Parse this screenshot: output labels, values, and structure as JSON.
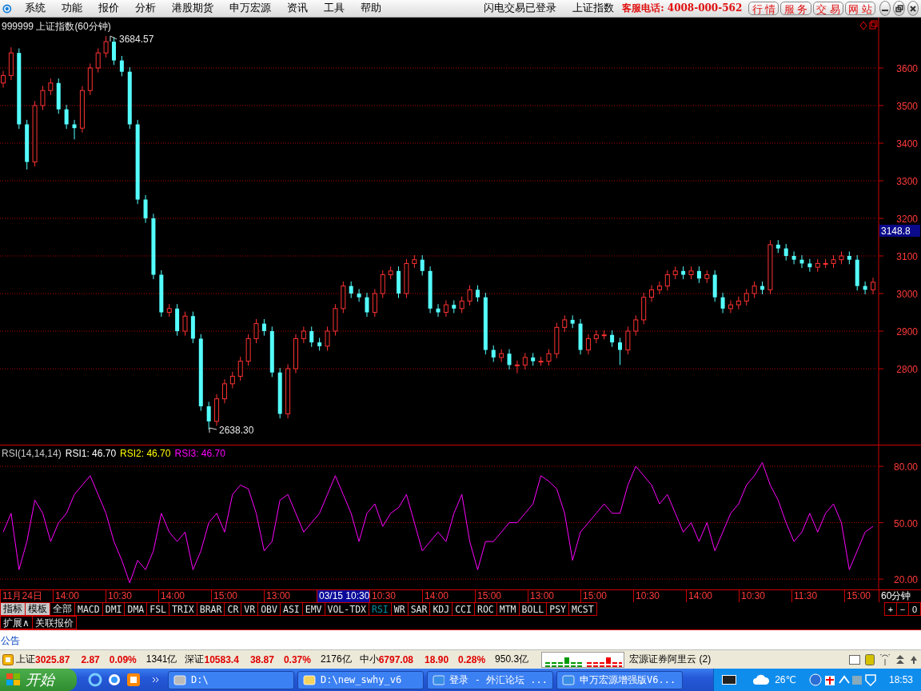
{
  "menu": {
    "items": [
      "系统",
      "功能",
      "报价",
      "分析",
      "港股期货",
      "申万宏源",
      "资讯",
      "工具",
      "帮助"
    ],
    "status": [
      "闪电交易已登录",
      "上证指数"
    ],
    "hotline": "客服电话: 4008-000-562",
    "buttons": [
      "行 情",
      "服 务",
      "交 易",
      "网 站"
    ]
  },
  "chart": {
    "title": "999999 上证指数(60分钟)",
    "high_label": "3684.57",
    "low_label": "2638.30",
    "current_price": "3148.8",
    "chart_data": {
      "type": "candlestick",
      "grid": true,
      "ylim": [
        2598,
        3734
      ],
      "yticks": [
        {
          "value": 3600,
          "label": "3600"
        },
        {
          "value": 3500,
          "label": "3500"
        },
        {
          "value": 3400,
          "label": "3400"
        },
        {
          "value": 3300,
          "label": "3300"
        },
        {
          "value": 3200,
          "label": "3200"
        },
        {
          "value": 3100,
          "label": "3100"
        },
        {
          "value": 3000,
          "label": "3000"
        },
        {
          "value": 2900,
          "label": "2900"
        },
        {
          "value": 2800,
          "label": "2800"
        }
      ],
      "ohlc": [
        [
          3560,
          3592,
          3548,
          3580
        ],
        [
          3580,
          3655,
          3568,
          3640
        ],
        [
          3640,
          3652,
          3438,
          3450
        ],
        [
          3450,
          3462,
          3330,
          3350
        ],
        [
          3350,
          3512,
          3338,
          3500
        ],
        [
          3500,
          3552,
          3488,
          3540
        ],
        [
          3540,
          3572,
          3528,
          3560
        ],
        [
          3560,
          3572,
          3478,
          3490
        ],
        [
          3490,
          3502,
          3438,
          3450
        ],
        [
          3450,
          3462,
          3410,
          3440
        ],
        [
          3440,
          3552,
          3428,
          3540
        ],
        [
          3540,
          3612,
          3528,
          3600
        ],
        [
          3600,
          3652,
          3588,
          3640
        ],
        [
          3640,
          3684.57,
          3628,
          3670
        ],
        [
          3670,
          3682,
          3608,
          3620
        ],
        [
          3620,
          3632,
          3578,
          3590
        ],
        [
          3590,
          3602,
          3438,
          3450
        ],
        [
          3450,
          3462,
          3238,
          3250
        ],
        [
          3250,
          3262,
          3188,
          3200
        ],
        [
          3200,
          3212,
          3038,
          3050
        ],
        [
          3050,
          3062,
          2938,
          2950
        ],
        [
          2950,
          2972,
          2938,
          2960
        ],
        [
          2960,
          2972,
          2888,
          2900
        ],
        [
          2900,
          2952,
          2888,
          2940
        ],
        [
          2940,
          2952,
          2868,
          2880
        ],
        [
          2880,
          2892,
          2688,
          2700
        ],
        [
          2700,
          2712,
          2638.3,
          2660
        ],
        [
          2660,
          2732,
          2648,
          2720
        ],
        [
          2720,
          2772,
          2708,
          2760
        ],
        [
          2760,
          2792,
          2748,
          2780
        ],
        [
          2780,
          2832,
          2768,
          2820
        ],
        [
          2820,
          2892,
          2808,
          2880
        ],
        [
          2880,
          2932,
          2868,
          2920
        ],
        [
          2920,
          2932,
          2888,
          2900
        ],
        [
          2900,
          2912,
          2778,
          2790
        ],
        [
          2790,
          2802,
          2668,
          2680
        ],
        [
          2680,
          2812,
          2668,
          2800
        ],
        [
          2800,
          2892,
          2788,
          2880
        ],
        [
          2880,
          2912,
          2868,
          2900
        ],
        [
          2900,
          2912,
          2858,
          2870
        ],
        [
          2870,
          2882,
          2848,
          2860
        ],
        [
          2860,
          2912,
          2848,
          2900
        ],
        [
          2900,
          2972,
          2888,
          2960
        ],
        [
          2960,
          3032,
          2948,
          3020
        ],
        [
          3020,
          3032,
          2988,
          3000
        ],
        [
          3000,
          3012,
          2978,
          2990
        ],
        [
          2990,
          3002,
          2938,
          2950
        ],
        [
          2950,
          3012,
          2938,
          3000
        ],
        [
          3000,
          3062,
          2988,
          3050
        ],
        [
          3050,
          3072,
          3038,
          3060
        ],
        [
          3060,
          3072,
          2988,
          3000
        ],
        [
          3000,
          3092,
          2988,
          3080
        ],
        [
          3080,
          3102,
          3068,
          3090
        ],
        [
          3090,
          3102,
          3048,
          3060
        ],
        [
          3060,
          3072,
          2948,
          2960
        ],
        [
          2960,
          2972,
          2938,
          2950
        ],
        [
          2950,
          2982,
          2938,
          2970
        ],
        [
          2970,
          2982,
          2948,
          2960
        ],
        [
          2960,
          2992,
          2948,
          2980
        ],
        [
          2980,
          3022,
          2968,
          3010
        ],
        [
          3010,
          3022,
          2978,
          2990
        ],
        [
          2990,
          3002,
          2838,
          2850
        ],
        [
          2850,
          2862,
          2818,
          2830
        ],
        [
          2830,
          2852,
          2818,
          2840
        ],
        [
          2840,
          2852,
          2798,
          2810
        ],
        [
          2810,
          2822,
          2788,
          2810
        ],
        [
          2810,
          2842,
          2798,
          2830
        ],
        [
          2830,
          2842,
          2808,
          2820
        ],
        [
          2820,
          2832,
          2808,
          2820
        ],
        [
          2820,
          2852,
          2808,
          2840
        ],
        [
          2840,
          2922,
          2828,
          2910
        ],
        [
          2910,
          2942,
          2898,
          2930
        ],
        [
          2930,
          2942,
          2908,
          2920
        ],
        [
          2920,
          2932,
          2838,
          2850
        ],
        [
          2850,
          2892,
          2838,
          2880
        ],
        [
          2880,
          2902,
          2868,
          2890
        ],
        [
          2890,
          2902,
          2878,
          2890
        ],
        [
          2890,
          2902,
          2858,
          2870
        ],
        [
          2870,
          2882,
          2810,
          2850
        ],
        [
          2850,
          2912,
          2838,
          2900
        ],
        [
          2900,
          2942,
          2888,
          2930
        ],
        [
          2930,
          3002,
          2918,
          2990
        ],
        [
          2990,
          3022,
          2978,
          3010
        ],
        [
          3010,
          3032,
          2998,
          3020
        ],
        [
          3020,
          3062,
          3008,
          3050
        ],
        [
          3050,
          3072,
          3038,
          3060
        ],
        [
          3060,
          3072,
          3038,
          3050
        ],
        [
          3050,
          3072,
          3038,
          3060
        ],
        [
          3060,
          3072,
          3028,
          3040
        ],
        [
          3040,
          3062,
          3028,
          3050
        ],
        [
          3050,
          3062,
          2978,
          2990
        ],
        [
          2990,
          3002,
          2948,
          2960
        ],
        [
          2960,
          2982,
          2948,
          2970
        ],
        [
          2970,
          2992,
          2958,
          2980
        ],
        [
          2980,
          3012,
          2968,
          3000
        ],
        [
          3000,
          3032,
          2988,
          3020
        ],
        [
          3020,
          3032,
          2998,
          3010
        ],
        [
          3010,
          3142,
          2998,
          3130
        ],
        [
          3130,
          3142,
          3108,
          3120
        ],
        [
          3120,
          3132,
          3088,
          3100
        ],
        [
          3100,
          3112,
          3078,
          3090
        ],
        [
          3090,
          3102,
          3068,
          3080
        ],
        [
          3080,
          3092,
          3058,
          3070
        ],
        [
          3070,
          3092,
          3058,
          3080
        ],
        [
          3080,
          3092,
          3068,
          3080
        ],
        [
          3080,
          3102,
          3068,
          3090
        ],
        [
          3090,
          3112,
          3078,
          3100
        ],
        [
          3100,
          3112,
          3078,
          3090
        ],
        [
          3090,
          3102,
          3008,
          3020
        ],
        [
          3020,
          3032,
          2998,
          3010
        ],
        [
          3010,
          3042,
          2998,
          3030
        ]
      ]
    }
  },
  "rsi": {
    "params": "RSI(14,14,14)",
    "values": [
      {
        "label": "RSI1: 46.70",
        "color": "#ffffff"
      },
      {
        "label": "RSI2: 46.70",
        "color": "#ffff00"
      },
      {
        "label": "RSI3: 46.70",
        "color": "#ff00ff"
      }
    ],
    "chart_data": {
      "type": "line",
      "grid": true,
      "ylim": [
        14.5,
        91.5
      ],
      "yticks": [
        {
          "value": 80,
          "label": "80.00"
        },
        {
          "value": 50,
          "label": "50.00"
        },
        {
          "value": 20,
          "label": "20.00"
        }
      ],
      "series": [
        {
          "color": "#ff00ff",
          "values": [
            45,
            55,
            25,
            40,
            62,
            55,
            40,
            50,
            55,
            65,
            70,
            75,
            65,
            55,
            40,
            30,
            18,
            30,
            25,
            35,
            55,
            45,
            40,
            45,
            25,
            35,
            50,
            55,
            45,
            65,
            70,
            68,
            55,
            35,
            40,
            62,
            65,
            55,
            45,
            50,
            55,
            65,
            75,
            65,
            55,
            40,
            55,
            60,
            48,
            55,
            58,
            65,
            50,
            35,
            40,
            45,
            40,
            55,
            65,
            40,
            25,
            40,
            40,
            45,
            50,
            50,
            55,
            60,
            75,
            72,
            68,
            55,
            30,
            45,
            50,
            55,
            60,
            55,
            55,
            70,
            80,
            75,
            70,
            60,
            65,
            55,
            45,
            50,
            40,
            50,
            35,
            45,
            55,
            60,
            70,
            75,
            82,
            70,
            62,
            50,
            40,
            45,
            55,
            45,
            55,
            60,
            50,
            25,
            35,
            45,
            48
          ]
        }
      ]
    }
  },
  "time_axis": {
    "labels": [
      {
        "text": "11月24日",
        "selected": false
      },
      {
        "text": "14:00",
        "selected": false
      },
      {
        "text": "10:30",
        "selected": false
      },
      {
        "text": "14:00",
        "selected": false
      },
      {
        "text": "15:00",
        "selected": false
      },
      {
        "text": "13:00",
        "selected": false
      },
      {
        "text": "03/15 10:30",
        "selected": true
      },
      {
        "text": "10:30",
        "selected": false
      },
      {
        "text": "14:00",
        "selected": false
      },
      {
        "text": "15:00",
        "selected": false
      },
      {
        "text": "13:00",
        "selected": false
      },
      {
        "text": "15:00",
        "selected": false
      },
      {
        "text": "10:30",
        "selected": false
      },
      {
        "text": "14:00",
        "selected": false
      },
      {
        "text": "10:30",
        "selected": false
      },
      {
        "text": "11:30",
        "selected": false
      },
      {
        "text": "15:00",
        "selected": false
      }
    ],
    "period": "60分钟"
  },
  "zoom_buttons": [
    "+",
    "−",
    "0"
  ],
  "indicator_tabs": [
    {
      "label": "指标",
      "kind": "mode",
      "selected": false
    },
    {
      "label": "模板",
      "kind": "mode",
      "selected": false
    },
    {
      "label": "全部",
      "kind": "indicator",
      "selected": false
    },
    {
      "label": "MACD",
      "kind": "indicator",
      "selected": false
    },
    {
      "label": "DMI",
      "kind": "indicator",
      "selected": false
    },
    {
      "label": "DMA",
      "kind": "indicator",
      "selected": false
    },
    {
      "label": "FSL",
      "kind": "indicator",
      "selected": false
    },
    {
      "label": "TRIX",
      "kind": "indicator",
      "selected": false
    },
    {
      "label": "BRAR",
      "kind": "indicator",
      "selected": false
    },
    {
      "label": "CR",
      "kind": "indicator",
      "selected": false
    },
    {
      "label": "VR",
      "kind": "indicator",
      "selected": false
    },
    {
      "label": "OBV",
      "kind": "indicator",
      "selected": false
    },
    {
      "label": "ASI",
      "kind": "indicator",
      "selected": false
    },
    {
      "label": "EMV",
      "kind": "indicator",
      "selected": false
    },
    {
      "label": "VOL-TDX",
      "kind": "indicator",
      "selected": false
    },
    {
      "label": "RSI",
      "kind": "indicator",
      "selected": true
    },
    {
      "label": "WR",
      "kind": "indicator",
      "selected": false
    },
    {
      "label": "SAR",
      "kind": "indicator",
      "selected": false
    },
    {
      "label": "KDJ",
      "kind": "indicator",
      "selected": false
    },
    {
      "label": "CCI",
      "kind": "indicator",
      "selected": false
    },
    {
      "label": "ROC",
      "kind": "indicator",
      "selected": false
    },
    {
      "label": "MTM",
      "kind": "indicator",
      "selected": false
    },
    {
      "label": "BOLL",
      "kind": "indicator",
      "selected": false
    },
    {
      "label": "PSY",
      "kind": "indicator",
      "selected": false
    },
    {
      "label": "MCST",
      "kind": "indicator",
      "selected": false
    }
  ],
  "sub_tabs": [
    "扩展∧",
    "关联报价"
  ],
  "notice": "公告",
  "quotes": [
    {
      "name": "上证",
      "price": "3025.87",
      "change": "2.87",
      "percent": "0.09%",
      "amount": "1341亿"
    },
    {
      "name": "深证",
      "price": "10583.4",
      "change": "38.87",
      "percent": "0.37%",
      "amount": "2176亿"
    },
    {
      "name": "中小",
      "price": "6797.08",
      "change": "18.90",
      "percent": "0.28%",
      "amount": "950.3亿"
    }
  ],
  "broker": "宏源证券阿里云 (2)",
  "taskbar": {
    "start": "开始",
    "tasks": [
      "D:\\",
      "D:\\new_swhy_v6",
      "登录 - 外汇论坛 ...",
      "申万宏源增强版V6..."
    ],
    "weather": "26℃",
    "clock": "18:53"
  }
}
